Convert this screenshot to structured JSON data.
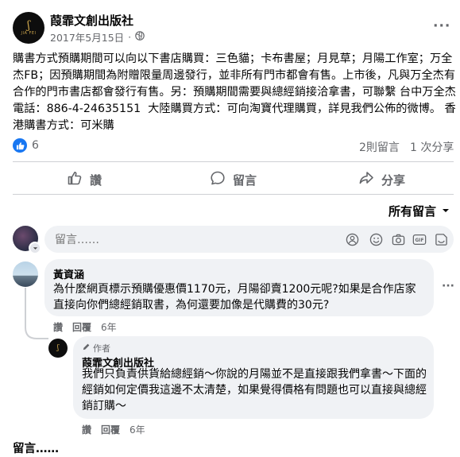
{
  "post": {
    "page_name": "葭霏文創出版社",
    "avatar_monogram": "ʃ",
    "avatar_brand": "JIA FEI",
    "date": "2017年5月15日",
    "text": "購書方式預購期間可以向以下書店購買：三色貓；卡布書屋；月見草；月陽工作室；万全杰FB；因預購期間為附贈限量周邊發行，並非所有門市都會有售。上市後，凡與万全杰有合作的門市書店都會發行有售。另：預購期間需要與總經銷接洽拿書，可聯繫 台中万全杰 電話：886-4-24635151  大陸購買方式：可向淘寶代理購買，詳見我們公佈的微博。 香港購書方式：可米購",
    "more_label": "···"
  },
  "reactions": {
    "like_count": "6",
    "comment_count": "2則留言",
    "share_count": "1 次分享"
  },
  "actions": {
    "like_label": "讚",
    "comment_label": "留言",
    "share_label": "分享"
  },
  "sort": {
    "label": "所有留言"
  },
  "composer": {
    "placeholder": "留言……"
  },
  "comments": [
    {
      "name": "黃資涵",
      "text": "為什麼網頁標示預購優惠價1170元，月陽卻賣1200元呢?如果是合作店家直接向你們總經銷取書，為何還要加像是代購費的30元?",
      "like": "讚",
      "reply": "回覆",
      "time": "6年",
      "more": "···"
    },
    {
      "author_badge": "作者",
      "name": "葭霏文創出版社",
      "text": "我們只負責供貨給總經銷～你說的月陽並不是直接跟我們拿書～下面的經銷如何定價我這邊不太清楚，如果覺得價格有問題也可以直接與總經銷訂購～",
      "like": "讚",
      "reply": "回覆",
      "time": "6年"
    }
  ],
  "footer": {
    "comment_label": "留言……"
  },
  "colors": {
    "accent": "#1877f2",
    "muted": "#65676b",
    "bubble": "#f0f2f5",
    "brand_gold": "#c9a24a"
  },
  "icons": [
    "globe-icon",
    "more-icon",
    "like-icon",
    "comment-icon",
    "share-icon",
    "chevron-down-icon",
    "sticker-icon",
    "emoji-icon",
    "camera-icon",
    "gif-icon",
    "avatar-sticker-icon",
    "pencil-icon"
  ]
}
